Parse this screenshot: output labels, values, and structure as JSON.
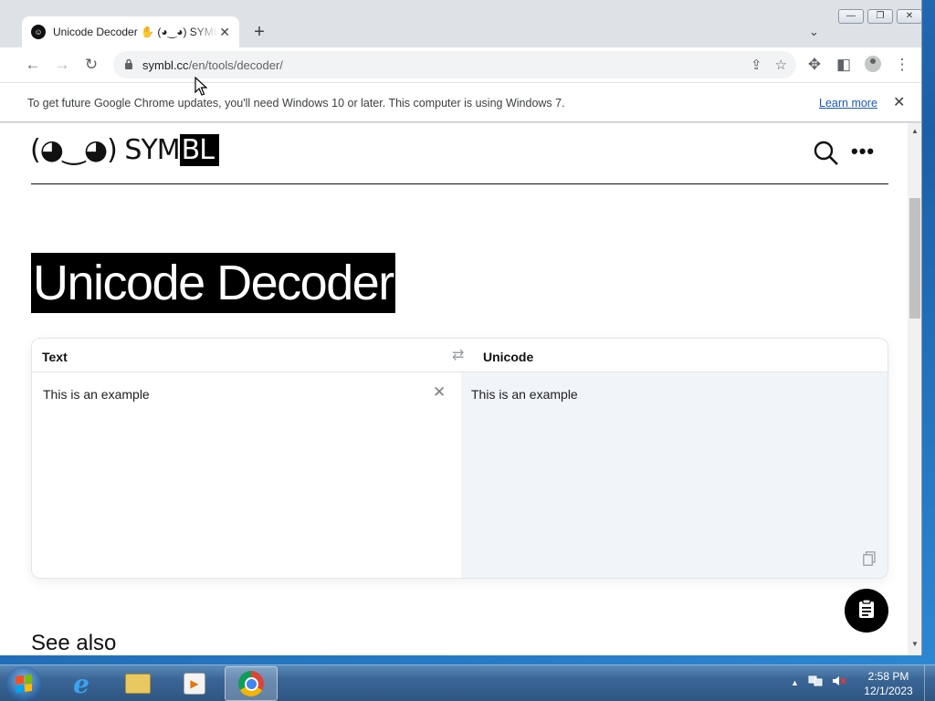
{
  "browser": {
    "tab": {
      "favicon_glyph": "☺",
      "title": "Unicode Decoder ✋ (◕‿◕) SYMBL",
      "close_glyph": "✕"
    },
    "new_tab_glyph": "+",
    "tab_search_glyph": "⌄",
    "window_controls": {
      "minimize": "—",
      "maximize": "❐",
      "close": "✕"
    },
    "toolbar": {
      "back": "←",
      "forward": "→",
      "reload": "↻",
      "url_host": "symbl.cc",
      "url_path": "/en/tools/decoder/",
      "share": "⇪",
      "bookmark": "☆",
      "extensions": "✥",
      "sidepanel": "◧",
      "menu": "⋮"
    },
    "infobar": {
      "message": "To get future Google Chrome updates, you'll need Windows 10 or later. This computer is using Windows 7.",
      "link": "Learn more",
      "close": "✕"
    }
  },
  "site": {
    "logo_text": "(◕‿◕) SYM",
    "logo_inverted": "BL",
    "menu_dots": "•••",
    "heading": "Unicode Decoder",
    "decoder": {
      "left_label": "Text",
      "right_label": "Unicode",
      "swap_glyph": "⇄",
      "input_value": "This is an example",
      "output_value": "This is an example",
      "clear_glyph": "✕"
    },
    "see_also": "See also"
  },
  "scrollbar": {
    "up": "▲",
    "down": "▼"
  },
  "taskbar": {
    "tray_arrow": "▲",
    "time": "2:58 PM",
    "date": "12/1/2023"
  },
  "colors": {
    "page_bg": "#ffffff",
    "output_panel_bg": "#f1f4f9",
    "heading_bg": "#000000",
    "link": "#1a57b8"
  },
  "icons": [
    "favicon-icon",
    "back-icon",
    "forward-icon",
    "reload-icon",
    "lock-icon",
    "share-icon",
    "star-icon",
    "extensions-icon",
    "sidepanel-icon",
    "profile-icon",
    "kebab-menu-icon",
    "close-icon",
    "search-icon",
    "more-icon",
    "swap-icon",
    "clear-icon",
    "copy-icon",
    "clipboard-icon",
    "windows-start-icon",
    "ie-icon",
    "explorer-icon",
    "media-player-icon",
    "chrome-icon"
  ]
}
